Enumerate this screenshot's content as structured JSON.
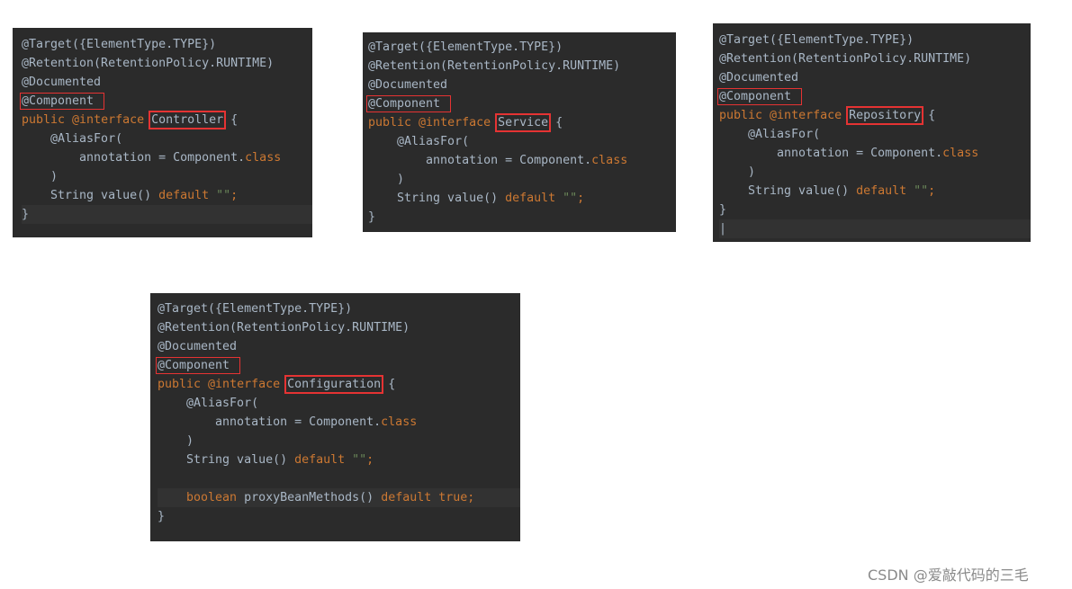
{
  "colors": {
    "background": "#2b2b2b",
    "keyword": "#cc7832",
    "text": "#a9b7c6",
    "string": "#6a8759",
    "highlight_box": "#e53333"
  },
  "panels": [
    {
      "id": "p1",
      "name": "controller-code-panel",
      "current_line": 9,
      "lines": [
        [
          [
            "@Target({ElementType.TYPE})",
            "ann"
          ]
        ],
        [
          [
            "@Retention(RetentionPolicy.RUNTIME)",
            "ann"
          ]
        ],
        [
          [
            "@Documented",
            "ann"
          ]
        ],
        [
          [
            "@Component",
            "ann",
            "thin"
          ]
        ],
        [
          [
            "public ",
            "kw"
          ],
          [
            "@interface ",
            "kw"
          ],
          [
            "Controller",
            "plain",
            "thick"
          ],
          [
            " {",
            "plain"
          ]
        ],
        [
          [
            "    @AliasFor(",
            "ann"
          ]
        ],
        [
          [
            "        annotation = Component.",
            "plain"
          ],
          [
            "class",
            "kw"
          ]
        ],
        [
          [
            "    )",
            "plain"
          ]
        ],
        [
          [
            "    String value() ",
            "plain"
          ],
          [
            "default ",
            "kw"
          ],
          [
            "\"\"",
            "str"
          ],
          [
            ";",
            "kw"
          ]
        ],
        [
          [
            "}",
            "plain"
          ]
        ]
      ]
    },
    {
      "id": "p2",
      "name": "service-code-panel",
      "current_line": -1,
      "lines": [
        [
          [
            "@Target({ElementType.TYPE})",
            "ann"
          ]
        ],
        [
          [
            "@Retention(RetentionPolicy.RUNTIME)",
            "ann"
          ]
        ],
        [
          [
            "@Documented",
            "ann"
          ]
        ],
        [
          [
            "@Component",
            "ann",
            "thin"
          ]
        ],
        [
          [
            "public ",
            "kw"
          ],
          [
            "@interface ",
            "kw"
          ],
          [
            "Service",
            "plain",
            "thick"
          ],
          [
            " {",
            "plain"
          ]
        ],
        [
          [
            "    @AliasFor(",
            "ann"
          ]
        ],
        [
          [
            "        annotation = Component.",
            "plain"
          ],
          [
            "class",
            "kw"
          ]
        ],
        [
          [
            "    )",
            "plain"
          ]
        ],
        [
          [
            "    String value() ",
            "plain"
          ],
          [
            "default ",
            "kw"
          ],
          [
            "\"\"",
            "str"
          ],
          [
            ";",
            "kw"
          ]
        ],
        [
          [
            "}",
            "plain"
          ]
        ]
      ]
    },
    {
      "id": "p3",
      "name": "repository-code-panel",
      "current_line": 10,
      "lines": [
        [
          [
            "@Target({ElementType.TYPE})",
            "ann"
          ]
        ],
        [
          [
            "@Retention(RetentionPolicy.RUNTIME)",
            "ann"
          ]
        ],
        [
          [
            "@Documented",
            "ann"
          ]
        ],
        [
          [
            "@Component",
            "ann",
            "thin"
          ]
        ],
        [
          [
            "public ",
            "kw"
          ],
          [
            "@interface ",
            "kw"
          ],
          [
            "Repository",
            "plain",
            "thick"
          ],
          [
            " {",
            "plain"
          ]
        ],
        [
          [
            "    @AliasFor(",
            "ann"
          ]
        ],
        [
          [
            "        annotation = Component.",
            "plain"
          ],
          [
            "class",
            "kw"
          ]
        ],
        [
          [
            "    )",
            "plain"
          ]
        ],
        [
          [
            "    String value() ",
            "plain"
          ],
          [
            "default ",
            "kw"
          ],
          [
            "\"\"",
            "str"
          ],
          [
            ";",
            "kw"
          ]
        ],
        [
          [
            "}",
            "plain"
          ]
        ],
        [
          [
            "|",
            "plain"
          ]
        ]
      ]
    },
    {
      "id": "p4",
      "name": "configuration-code-panel",
      "current_line": 10,
      "lines": [
        [
          [
            "@Target({ElementType.TYPE})",
            "ann"
          ]
        ],
        [
          [
            "@Retention(RetentionPolicy.RUNTIME)",
            "ann"
          ]
        ],
        [
          [
            "@Documented",
            "ann"
          ]
        ],
        [
          [
            "@Component",
            "ann",
            "thin"
          ]
        ],
        [
          [
            "public ",
            "kw"
          ],
          [
            "@interface ",
            "kw"
          ],
          [
            "Configuration",
            "plain",
            "thick"
          ],
          [
            " {",
            "plain"
          ]
        ],
        [
          [
            "    @AliasFor(",
            "ann"
          ]
        ],
        [
          [
            "        annotation = Component.",
            "plain"
          ],
          [
            "class",
            "kw"
          ]
        ],
        [
          [
            "    )",
            "plain"
          ]
        ],
        [
          [
            "    String value() ",
            "plain"
          ],
          [
            "default ",
            "kw"
          ],
          [
            "\"\"",
            "str"
          ],
          [
            ";",
            "kw"
          ]
        ],
        [
          [
            "",
            "plain"
          ]
        ],
        [
          [
            "    boolean ",
            "kw"
          ],
          [
            "proxyBeanMethods() ",
            "plain"
          ],
          [
            "default ",
            "kw"
          ],
          [
            "true",
            "kw"
          ],
          [
            ";",
            "kw"
          ]
        ],
        [
          [
            "}",
            "plain"
          ]
        ]
      ]
    }
  ],
  "watermark": "CSDN @爱敲代码的三毛"
}
